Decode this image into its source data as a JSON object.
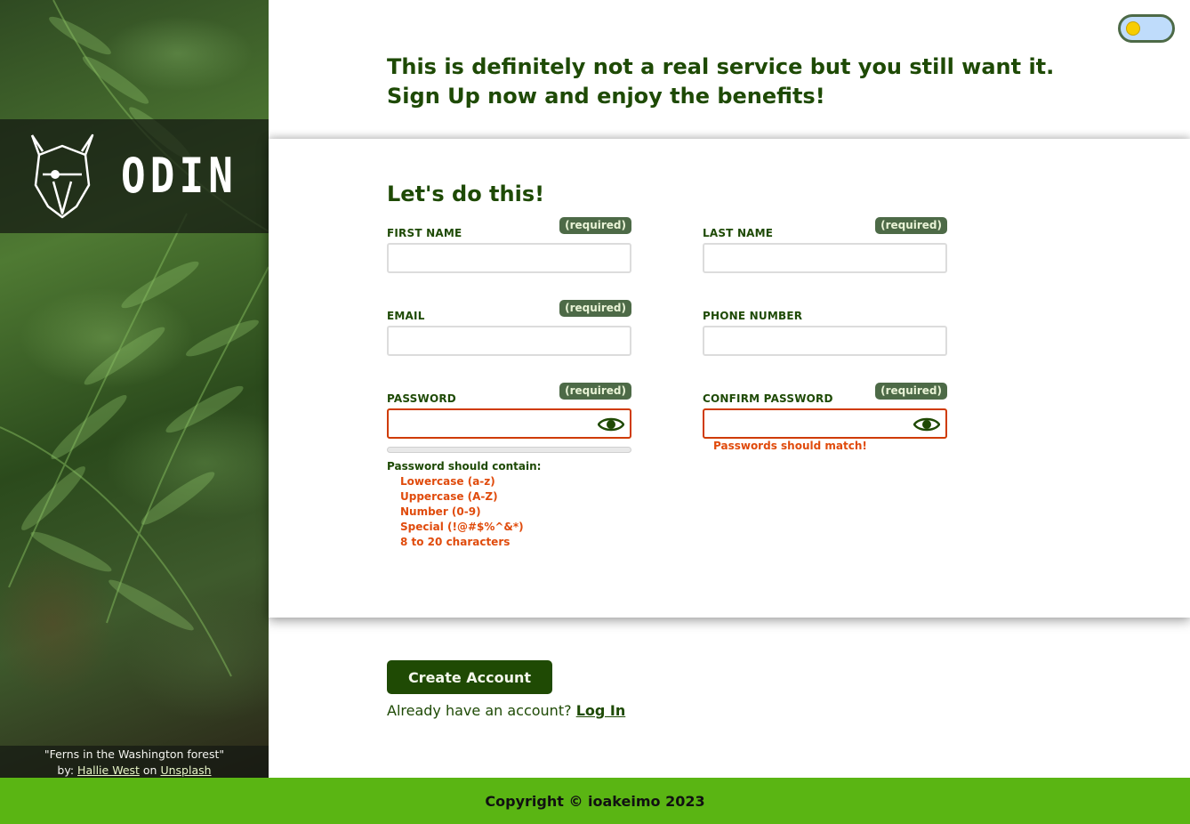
{
  "sidebar": {
    "logo_text": "ODIN",
    "photo_credit": {
      "title": "\"Ferns in the Washington forest\"",
      "by_prefix": "by:",
      "author": "Hallie West",
      "on_word": "on",
      "site": "Unsplash"
    }
  },
  "header": {
    "tagline": "This is definitely not a real service but you still want it. Sign Up now and enjoy the benefits!"
  },
  "theme_toggle": {
    "icon": "sun-icon",
    "knob_color": "#f7cd00",
    "track_color": "#bfdcfb"
  },
  "form": {
    "title": "Let's do this!",
    "required_badge": "(required)",
    "fields": {
      "first_name": {
        "label": "FIRST NAME",
        "value": ""
      },
      "last_name": {
        "label": "LAST NAME",
        "value": ""
      },
      "email": {
        "label": "EMAIL",
        "value": ""
      },
      "phone": {
        "label": "PHONE NUMBER",
        "value": ""
      },
      "password": {
        "label": "PASSWORD",
        "value": ""
      },
      "confirm_password": {
        "label": "CONFIRM PASSWORD",
        "value": ""
      }
    },
    "password_rules": {
      "title": "Password should contain:",
      "items": [
        "Lowercase (a-z)",
        "Uppercase (A-Z)",
        "Number (0-9)",
        "Special (!@#$%^&*)",
        "8 to 20 characters"
      ]
    },
    "password_strength": 0,
    "match_error": "Passwords should match!"
  },
  "actions": {
    "create_label": "Create Account",
    "login_prompt": "Already have an account?",
    "login_link": "Log In"
  },
  "footer": {
    "copyright": "Copyright © ioakeimo 2023"
  },
  "colors": {
    "primary": "#1f4a04",
    "badge": "#4d6a47",
    "error": "#e04b0c",
    "footer": "#5ab513"
  }
}
